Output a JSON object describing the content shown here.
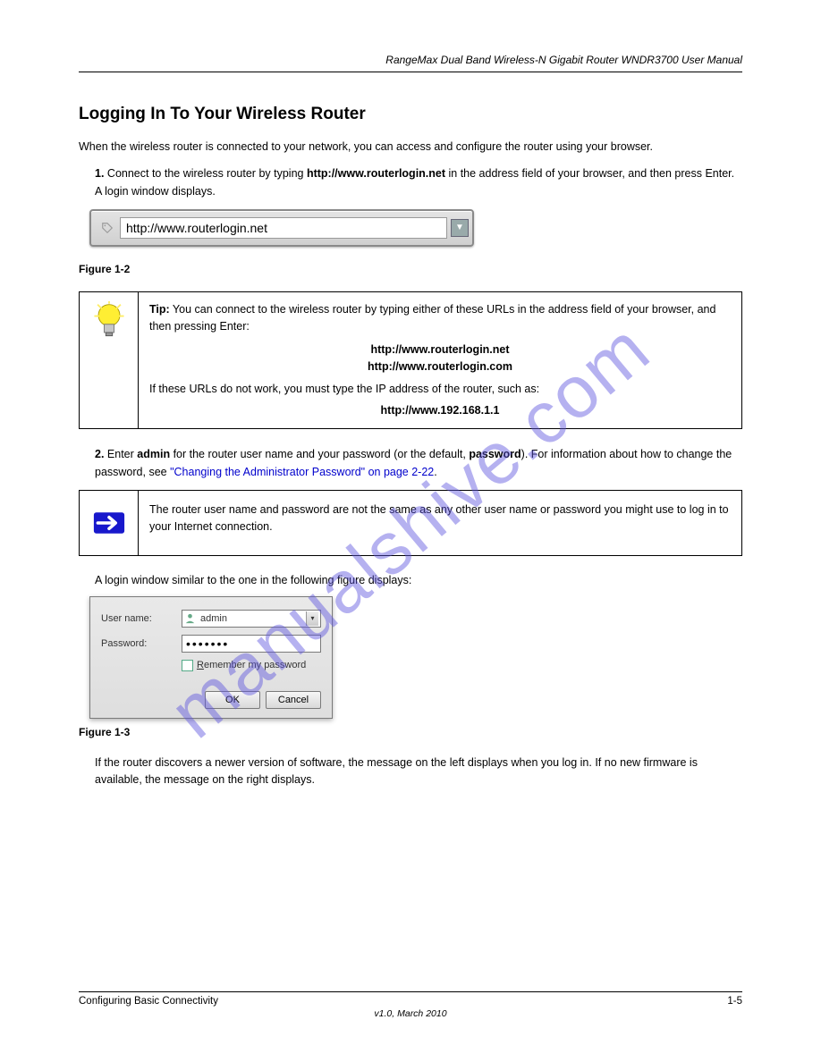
{
  "header": {
    "doc_title": "RangeMax Dual Band Wireless-N Gigabit Router WNDR3700 User Manual"
  },
  "section": {
    "title": "Logging In To Your Wireless Router"
  },
  "intro_text": "When the wireless router is connected to your network, you can access and configure the router using your browser.",
  "step1": {
    "prefix": "1.",
    "text_a": "Connect to the wireless router by typing ",
    "url_bold": "http://www.routerlogin.net",
    "text_b": " in the address field of your browser, and then press Enter. A login window displays."
  },
  "urlbar": {
    "value": "http://www.routerlogin.net"
  },
  "figure1": "Figure 1-2",
  "tip": {
    "label": "Tip:",
    "body_a": " You can connect to the wireless router by typing either of these URLs in the address field of your browser, and then pressing Enter:",
    "addr1": "http://www.routerlogin.net",
    "addr2": "http://www.routerlogin.com",
    "body_b": "If these URLs do not work, you must type the IP address of the router, such as:",
    "addr3": "http://www.192.168.1.1"
  },
  "step2": {
    "prefix": "2.",
    "text_a": "Enter ",
    "admin": "admin",
    "text_b": " for the router user name and your password (or the default, ",
    "pwd": "password",
    "text_c": "). For information about how to change the password, see ",
    "link": "\"Changing the Administrator Password\" on page 2-22",
    "text_d": "."
  },
  "note": {
    "body": "The router user name and password are not the same as any other user name or password you might use to log in to your Internet connection."
  },
  "dropshield": "A login window similar to the one in the following figure displays:",
  "login": {
    "username_label": "User name:",
    "username_value": "admin",
    "password_label": "Password:",
    "password_mask": "•••••••",
    "remember_prefix": "R",
    "remember_text": "emember my password",
    "ok": "OK",
    "cancel": "Cancel"
  },
  "figure2": "Figure 1-3",
  "post_login": "If the router discovers a newer version of software, the message on the left displays when you log in. If no new firmware is available, the message on the right displays.",
  "footer": {
    "left": "Configuring Basic Connectivity",
    "right": "1-5",
    "version": "v1.0, March 2010"
  },
  "watermark": "manualshive.com"
}
